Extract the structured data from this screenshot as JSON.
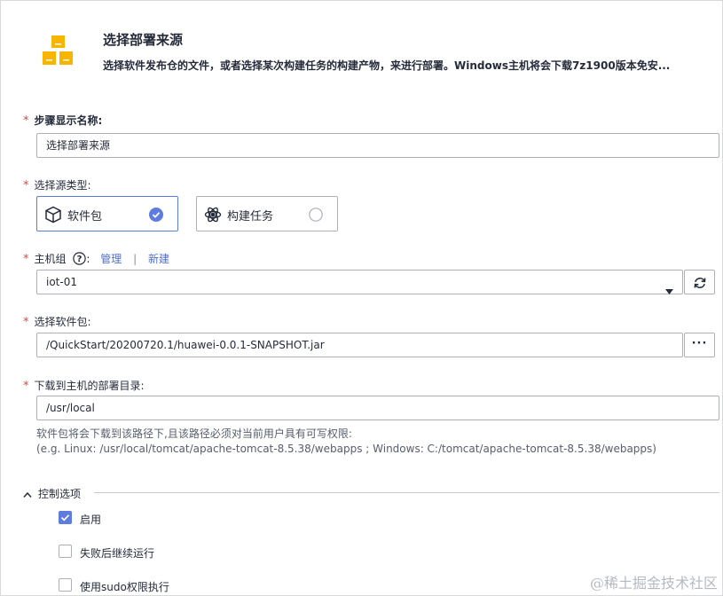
{
  "header": {
    "title": "选择部署来源",
    "description": "选择软件发布仓的文件，或者选择某次构建任务的构建产物，来进行部署。Windows主机将会下载7z1900版本免安..."
  },
  "step_name": {
    "required": "*",
    "label": "步骤显示名称:",
    "value": "选择部署来源"
  },
  "source_type": {
    "required": "*",
    "label": "选择源类型:",
    "options": [
      {
        "label": "软件包",
        "selected": true
      },
      {
        "label": "构建任务",
        "selected": false
      }
    ]
  },
  "host_group": {
    "required": "*",
    "label": "主机组",
    "colon": ":",
    "manage_link": "管理",
    "separator": "|",
    "new_link": "新建",
    "value": "iot-01"
  },
  "package": {
    "required": "*",
    "label": "选择软件包:",
    "value": "/QuickStart/20200720.1/huawei-0.0.1-SNAPSHOT.jar",
    "browse_label": "···"
  },
  "deploy_dir": {
    "required": "*",
    "label": "下载到主机的部署目录:",
    "value": "/usr/local",
    "hint_line1": "软件包将会下载到该路径下,且该路径必须对当前用户具有可写权限:",
    "hint_line2": "(e.g. Linux: /usr/local/tomcat/apache-tomcat-8.5.38/webapps ; Windows: C:/tomcat/apache-tomcat-8.5.38/webapps)"
  },
  "control_options": {
    "title": "控制选项",
    "items": [
      {
        "label": "启用",
        "checked": true
      },
      {
        "label": "失败后继续运行",
        "checked": false
      },
      {
        "label": "使用sudo权限执行",
        "checked": false
      }
    ]
  },
  "watermark": "@稀土掘金技术社区",
  "colors": {
    "accent": "#5e7ce0",
    "required": "#e54545",
    "link": "#526ecc",
    "icon_orange": "#f7b500"
  }
}
